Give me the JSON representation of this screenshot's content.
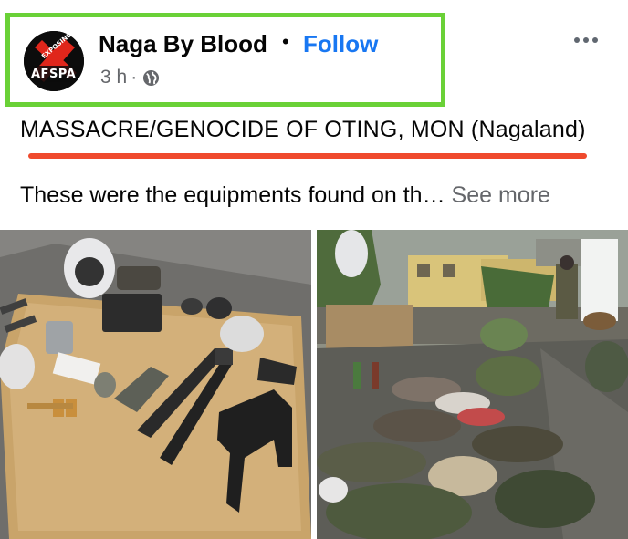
{
  "post": {
    "page_name": "Naga By Blood",
    "separator": "•",
    "follow_label": "Follow",
    "time": "3 h",
    "meta_dot": "·",
    "audience_icon": "globe-icon",
    "more_icon": "more-horizontal-icon",
    "title": "MASSACRE/GENOCIDE OF OTING, MON (Nagaland)",
    "body_text": "These were the equipments found on th…",
    "see_more_label": "See more"
  },
  "avatar": {
    "logo_top": "EXPOSING",
    "logo_main": "AFSPA"
  },
  "colors": {
    "highlight_box": "#6ad137",
    "underline": "#ef4a2d",
    "link": "#1877f2",
    "secondary_text": "#65676b"
  },
  "photos": [
    {
      "name": "photo-equipment-on-tarp"
    },
    {
      "name": "photo-clothing-on-ground"
    }
  ]
}
